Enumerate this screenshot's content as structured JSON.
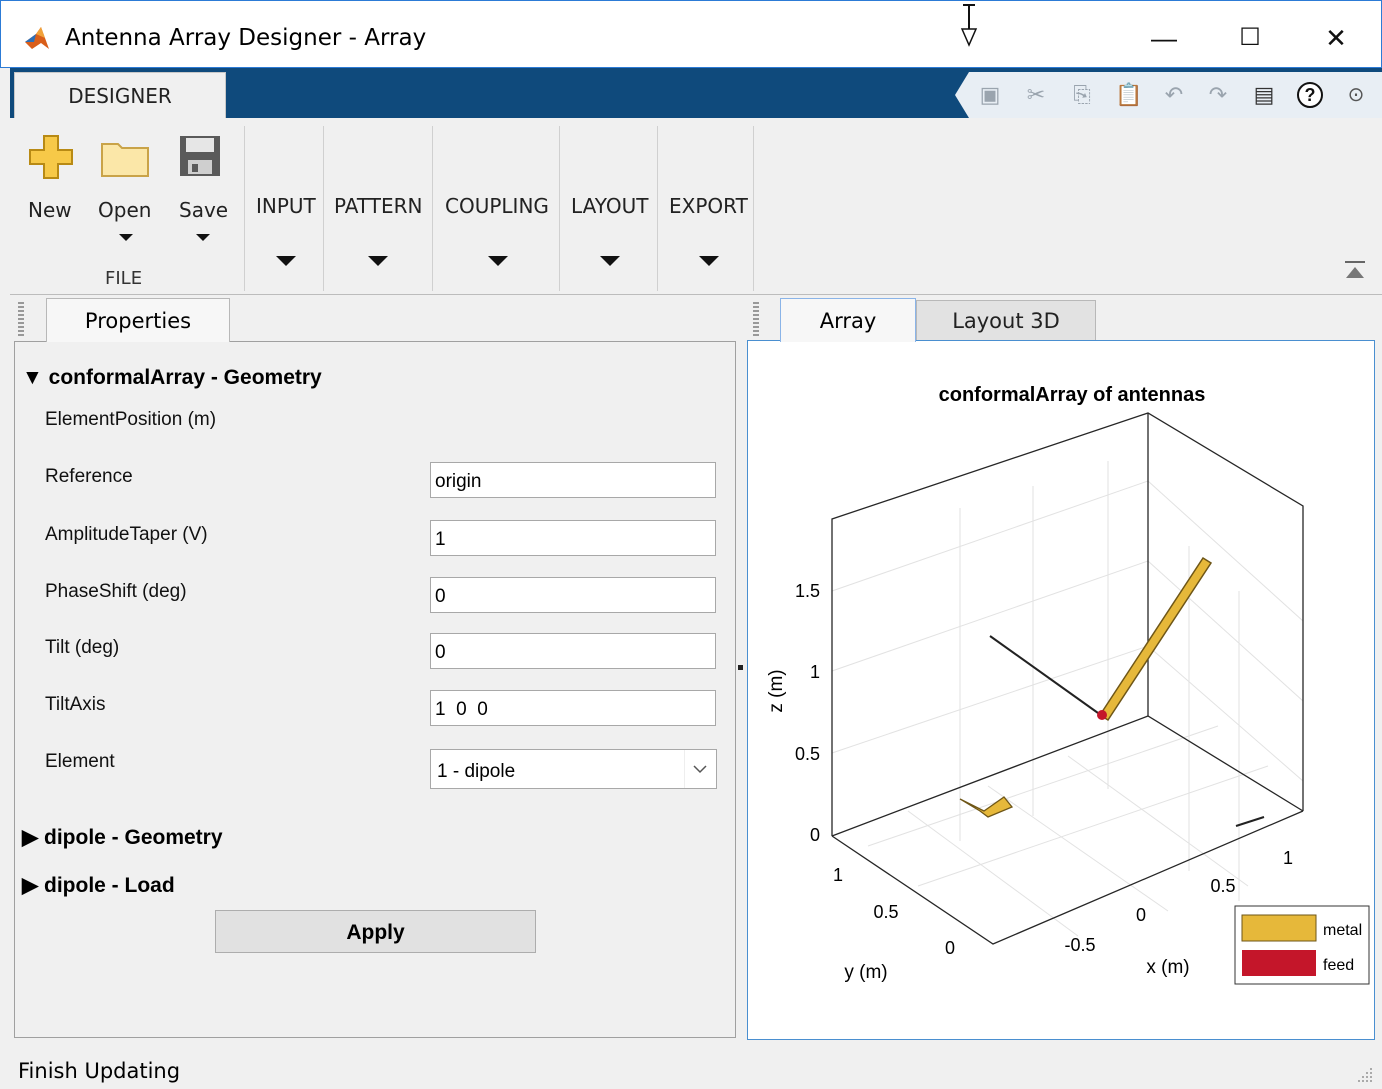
{
  "window": {
    "title": "Antenna Array Designer - Array",
    "minimize": "—",
    "maximize": "☐",
    "close": "✕"
  },
  "ribbon": {
    "tab": "DESIGNER",
    "file_group": "FILE",
    "new": "New",
    "open": "Open",
    "save": "Save",
    "input": "INPUT",
    "pattern": "PATTERN",
    "coupling": "COUPLING",
    "layout": "LAYOUT",
    "export": "EXPORT"
  },
  "properties": {
    "tab": "Properties",
    "section1": "conformalArray - Geometry",
    "element_position_label": "ElementPosition (m)",
    "reference_label": "Reference",
    "reference_value": "origin",
    "amplitude_label": "AmplitudeTaper (V)",
    "amplitude_value": "1",
    "phase_label": "PhaseShift (deg)",
    "phase_value": "0",
    "tilt_label": "Tilt (deg)",
    "tilt_value": "0",
    "tiltaxis_label": "TiltAxis",
    "tiltaxis_value": "1  0  0",
    "element_label": "Element",
    "element_value": "1 - dipole",
    "section2": "dipole - Geometry",
    "section3": "dipole - Load",
    "apply": "Apply"
  },
  "view": {
    "tab_array": "Array",
    "tab_layout3d": "Layout 3D"
  },
  "chart_data": {
    "type": "3d-line",
    "title": "conformalArray of antennas",
    "xlabel": "x (m)",
    "ylabel": "y (m)",
    "zlabel": "z (m)",
    "xticks": [
      "-0.5",
      "0",
      "0.5",
      "1"
    ],
    "yticks": [
      "0",
      "0.5",
      "1"
    ],
    "zticks": [
      "0",
      "0.5",
      "1",
      "1.5"
    ],
    "legend": [
      "metal",
      "feed"
    ],
    "colors": {
      "metal": "#e6b83a",
      "feed": "#c4162a"
    },
    "legend_placement": "bottom-right",
    "grid": true
  },
  "status": "Finish Updating"
}
